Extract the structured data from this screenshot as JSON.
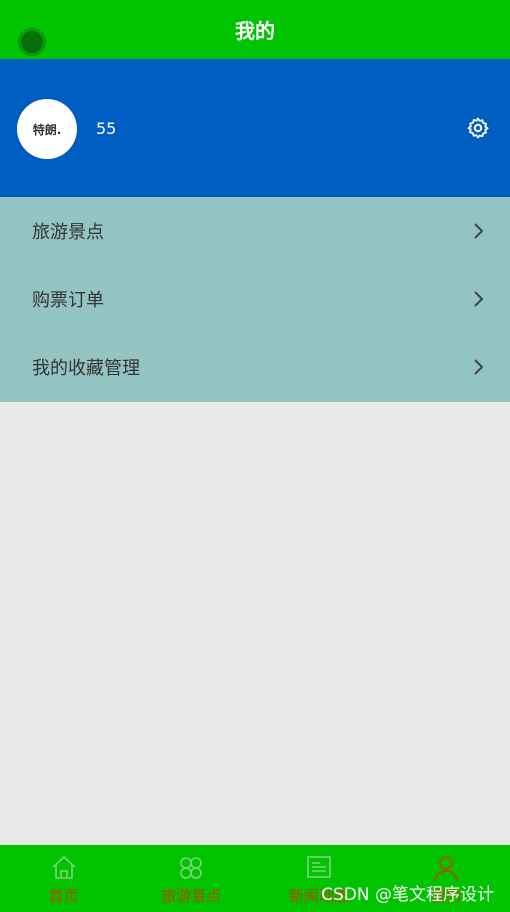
{
  "header": {
    "title": "我的"
  },
  "profile": {
    "avatar_text": "特朗.",
    "username": "55"
  },
  "menu": [
    {
      "label": "旅游景点"
    },
    {
      "label": "购票订单"
    },
    {
      "label": "我的收藏管理"
    }
  ],
  "tabs": [
    {
      "label": "首页",
      "icon": "home-icon"
    },
    {
      "label": "旅游景点",
      "icon": "clover-icon"
    },
    {
      "label": "新闻动态",
      "icon": "news-icon"
    },
    {
      "label": "我的",
      "icon": "user-icon"
    }
  ],
  "watermark": "CSDN @笔文程序设计",
  "colors": {
    "header": "#00c400",
    "profile": "#005ec2",
    "menu": "#94c3c3",
    "background": "#e8e9e9",
    "tab_label": "#b34a00"
  }
}
